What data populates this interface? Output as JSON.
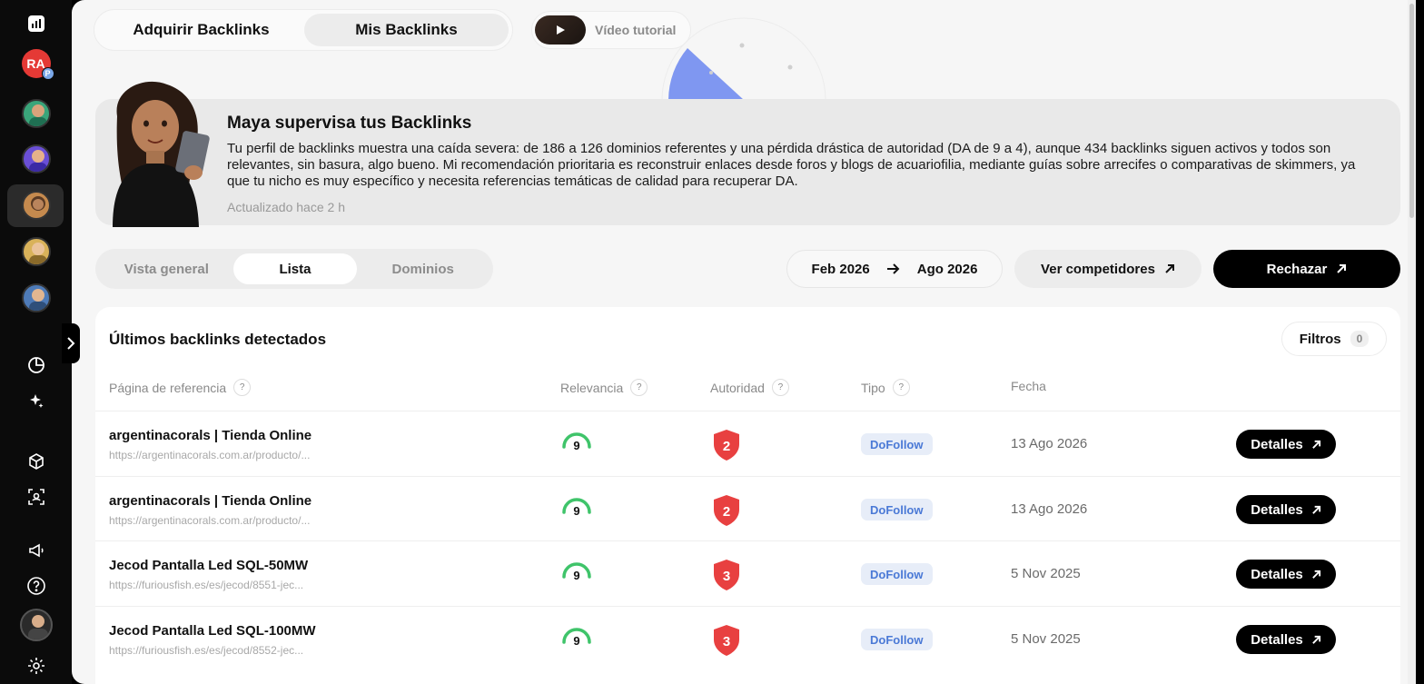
{
  "rail": {
    "user_initials": "RA",
    "user_badge": "P"
  },
  "top_tabs": {
    "acquire_label": "Adquirir Backlinks",
    "mine_label": "Mis Backlinks"
  },
  "video": {
    "label": "Vídeo tutorial"
  },
  "maya": {
    "title": "Maya supervisa tus Backlinks",
    "text": "Tu perfil de backlinks muestra una caída severa: de 186 a 126 dominios referentes y una pérdida drástica de autoridad (DA de 9 a 4), aunque 434 backlinks siguen activos y todos son relevantes, sin basura, algo bueno. Mi recomendación prioritaria es reconstruir enlaces desde foros y blogs de acuariofilia, mediante guías sobre arrecifes o comparativas de skimmers, ya que tu nicho es muy específico y necesita referencias temáticas de calidad para recuperar DA.",
    "updated": "Actualizado hace 2 h"
  },
  "view_tabs": {
    "overview": "Vista general",
    "list": "Lista",
    "domains": "Dominios"
  },
  "date_range": {
    "from": "Feb 2026",
    "to": "Ago 2026"
  },
  "actions": {
    "competitors": "Ver competidores",
    "reject": "Rechazar"
  },
  "table": {
    "title": "Últimos backlinks detectados",
    "filters_label": "Filtros",
    "filters_count": "0",
    "headers": {
      "ref": "Página de referencia",
      "relevance": "Relevancia",
      "authority": "Autoridad",
      "type": "Tipo",
      "date": "Fecha",
      "help": "?"
    },
    "details_label": "Detalles",
    "rows": [
      {
        "title": "argentinacorals | Tienda Online",
        "url": "https://argentinacorals.com.ar/producto/...",
        "relevance": "9",
        "authority": "2",
        "type": "DoFollow",
        "date": "13 Ago 2026"
      },
      {
        "title": "argentinacorals | Tienda Online",
        "url": "https://argentinacorals.com.ar/producto/...",
        "relevance": "9",
        "authority": "2",
        "type": "DoFollow",
        "date": "13 Ago 2026"
      },
      {
        "title": "Jecod Pantalla Led SQL-50MW",
        "url": "https://furiousfish.es/es/jecod/8551-jec...",
        "relevance": "9",
        "authority": "3",
        "type": "DoFollow",
        "date": "5 Nov 2025"
      },
      {
        "title": "Jecod Pantalla Led SQL-100MW",
        "url": "https://furiousfish.es/es/jecod/8552-jec...",
        "relevance": "9",
        "authority": "3",
        "type": "DoFollow",
        "date": "5 Nov 2025"
      }
    ]
  },
  "colors": {
    "accent_black": "#000000",
    "relevance_green": "#3fc46a",
    "authority_red": "#e84040",
    "dofollow_blue": "#4a79d6"
  }
}
